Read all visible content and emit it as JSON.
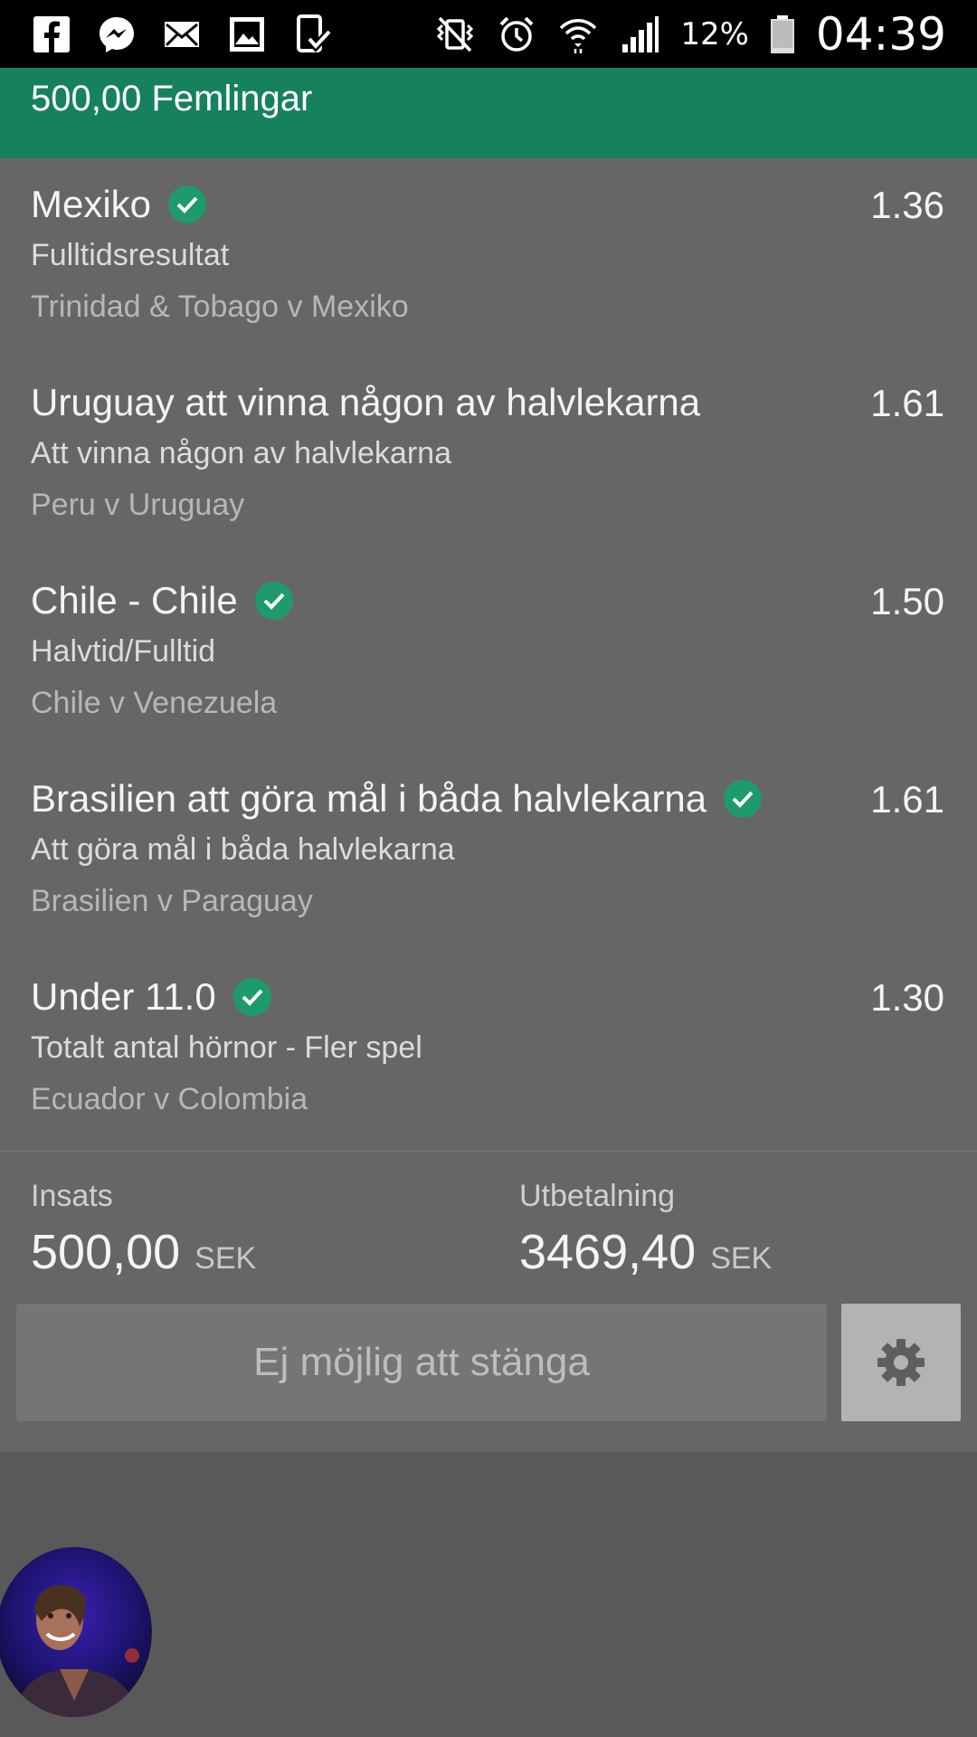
{
  "status_bar": {
    "left_icons": [
      "facebook-icon",
      "messenger-icon",
      "mail-icon",
      "gallery-icon",
      "download-icon"
    ],
    "right_icons": [
      "vibrate-icon",
      "alarm-icon",
      "wifi-icon",
      "signal-icon",
      "battery-icon"
    ],
    "battery": "12%",
    "time": "04:39"
  },
  "header": {
    "title": "500,00 Femlingar",
    "color": "#17805e"
  },
  "bets": [
    {
      "selection": "Mexiko",
      "won": true,
      "odds": "1.36",
      "market": "Fulltidsresultat",
      "event": "Trinidad & Tobago v Mexiko"
    },
    {
      "selection": "Uruguay att vinna någon av halvlekarna",
      "won": false,
      "odds": "1.61",
      "market": "Att vinna någon av halvlekarna",
      "event": "Peru v Uruguay"
    },
    {
      "selection": "Chile - Chile",
      "won": true,
      "odds": "1.50",
      "market": "Halvtid/Fulltid",
      "event": "Chile v Venezuela"
    },
    {
      "selection": "Brasilien att göra mål i båda halvlekarna",
      "won": true,
      "odds": "1.61",
      "market": "Att göra mål i båda halvlekarna",
      "event": "Brasilien v Paraguay"
    },
    {
      "selection": "Under 11.0",
      "won": true,
      "odds": "1.30",
      "market": "Totalt antal hörnor - Fler spel",
      "event": "Ecuador v Colombia"
    }
  ],
  "summary": {
    "stake_label": "Insats",
    "stake_value": "500,00",
    "stake_currency": "SEK",
    "payout_label": "Utbetalning",
    "payout_value": "3469,40",
    "payout_currency": "SEK",
    "close_button": "Ej möjlig att stänga",
    "settings_icon": "gear-icon"
  },
  "colors": {
    "accent": "#17805e",
    "check": "#1e9a6c"
  }
}
